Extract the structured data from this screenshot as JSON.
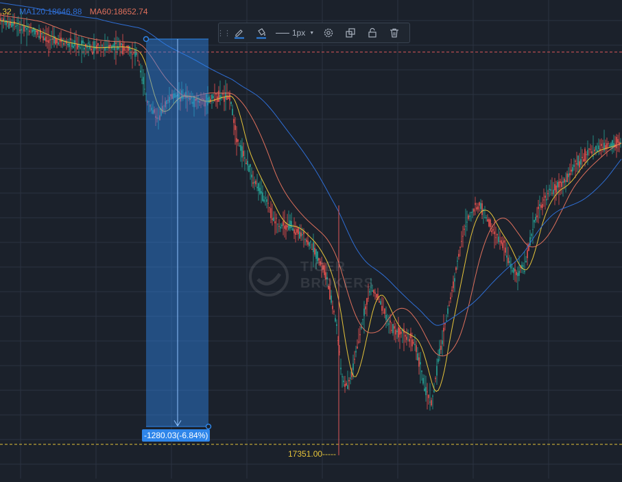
{
  "legend": {
    "partial_value": ".32",
    "ma120": "MA120:18646.88",
    "ma60": "MA60:18652.74",
    "colors": {
      "partial": "#e7c53a",
      "ma120": "#2f6fd6",
      "ma60": "#e0705c"
    }
  },
  "toolbar": {
    "icons": [
      "grip-icon",
      "pencil-icon",
      "fill-bucket-icon",
      "settings-icon",
      "clone-icon",
      "lock-icon",
      "trash-icon"
    ],
    "line_width_label": "1px"
  },
  "measure": {
    "label": "-1280.03(-6.84%)",
    "color": "#2f86ea"
  },
  "price_marker": {
    "label": "17351.00-----",
    "color": "#e7c53a"
  },
  "watermark": {
    "text_line1": "TIGER",
    "text_line2": "BROKERS"
  },
  "chart_data": {
    "type": "candlestick",
    "title": "",
    "series": [
      {
        "name": "MA60",
        "color": "#e0705c"
      },
      {
        "name": "MA120",
        "color": "#2f6fd6"
      }
    ],
    "measured_change": -1280.03,
    "measured_change_pct": -6.84,
    "low_marker": 17351.0,
    "ma120_value": 18646.88,
    "ma60_value": 18652.74,
    "grid": true,
    "colors": {
      "up": "#26a69a",
      "down": "#ef5350",
      "fast_ma": "#e7c53a",
      "background": "#1b212b",
      "grid": "#2b3340"
    }
  }
}
